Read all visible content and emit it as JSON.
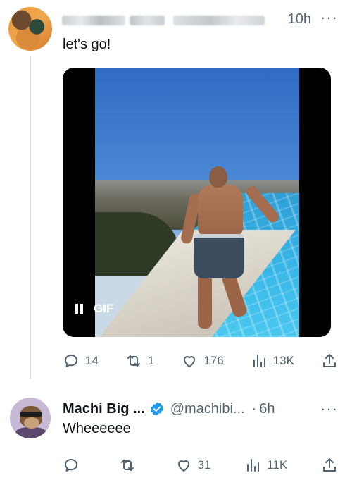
{
  "tweet1": {
    "time": "10h",
    "more": "···",
    "text": "let's go!",
    "media": {
      "badge": "GIF"
    },
    "actions": {
      "replies": "14",
      "retweets": "1",
      "likes": "176",
      "views": "13K"
    }
  },
  "tweet2": {
    "name": "Machi Big ...",
    "handle": "@machibi...",
    "dot": "·",
    "time": "6h",
    "more": "···",
    "text": "Wheeeeee",
    "actions": {
      "replies": "",
      "retweets": "",
      "likes": "31",
      "views": "11K"
    }
  },
  "colors": {
    "text": "#0f1419",
    "muted": "#536471",
    "verified": "#1d9bf0",
    "thread_line": "#cfd9de"
  }
}
